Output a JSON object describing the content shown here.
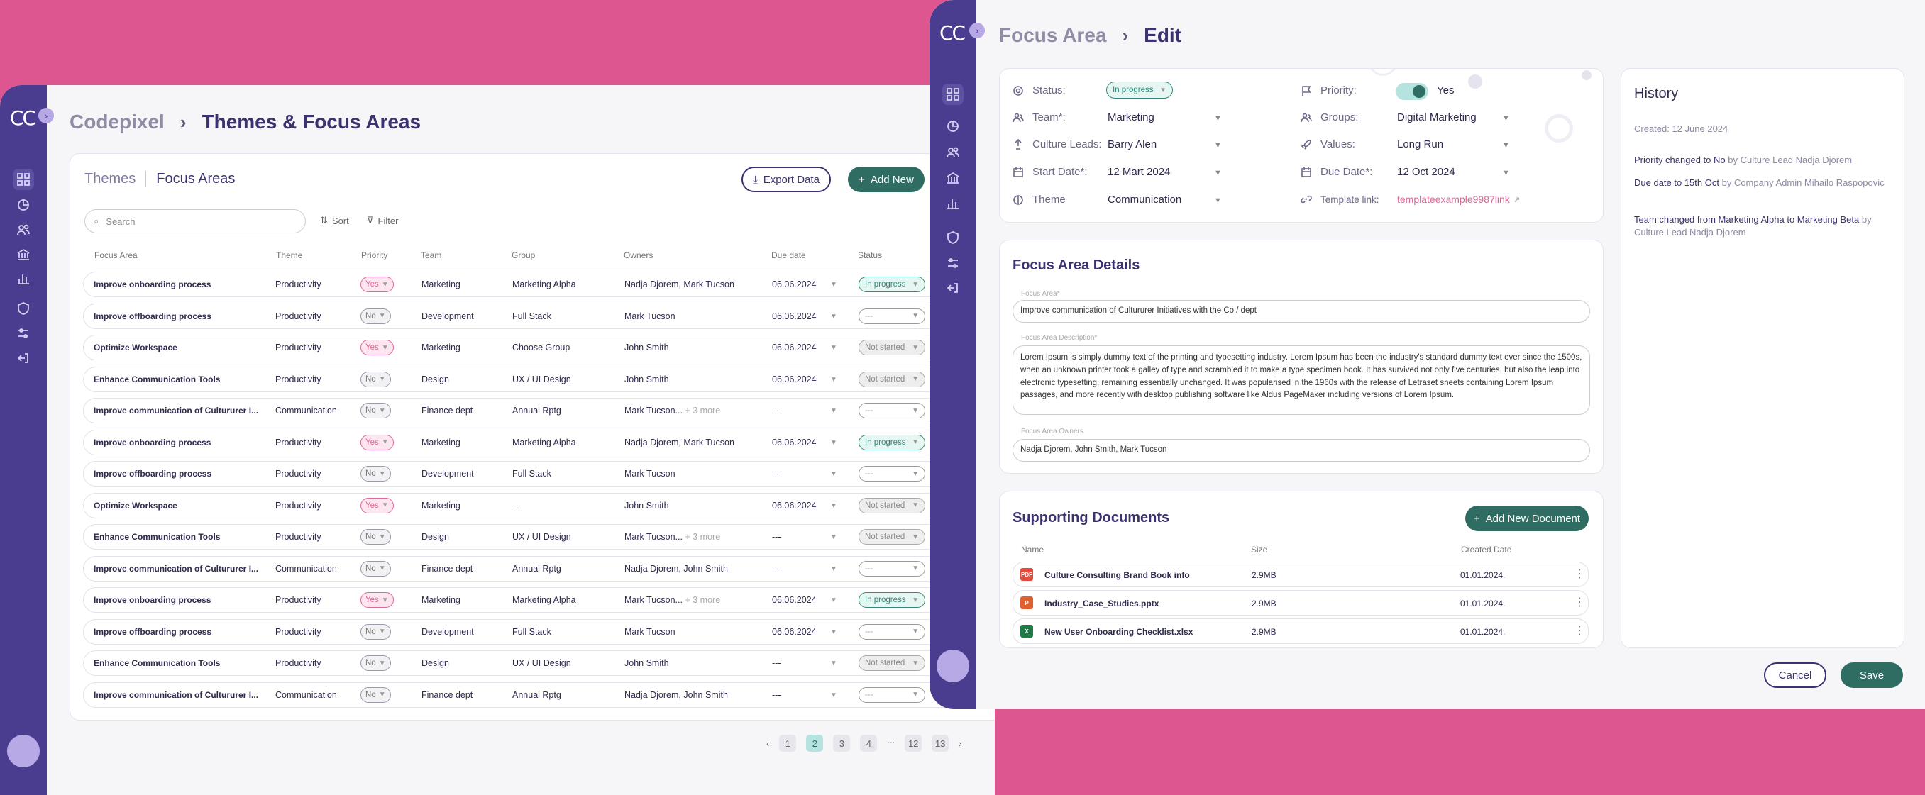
{
  "brand": {
    "logo": "CC",
    "toggle": "›"
  },
  "left": {
    "breadcrumb": [
      "Codepixel",
      "Themes & Focus Areas"
    ],
    "tabs": [
      "Themes",
      "Focus Areas"
    ],
    "export_label": "Export Data",
    "add_label": "Add New",
    "search_placeholder": "Search",
    "sort_label": "Sort",
    "filter_label": "Filter",
    "columns": [
      "Focus Area",
      "Theme",
      "Priority",
      "Team",
      "Group",
      "Owners",
      "Due date",
      "Status"
    ],
    "rows": [
      {
        "fa": "Improve onboarding process",
        "theme": "Productivity",
        "priority": "Yes",
        "team": "Marketing",
        "group": "Marketing Alpha",
        "owners": "Nadja Djorem, Mark Tucson",
        "more": "",
        "due": "06.06.2024",
        "status": "In progress"
      },
      {
        "fa": "Improve offboarding process",
        "theme": "Productivity",
        "priority": "No",
        "team": "Development",
        "group": "Full Stack",
        "owners": "Mark Tucson",
        "more": "",
        "due": "06.06.2024",
        "status": "---"
      },
      {
        "fa": "Optimize Workspace",
        "theme": "Productivity",
        "priority": "Yes",
        "team": "Marketing",
        "group": "Choose Group",
        "owners": "John Smith",
        "more": "",
        "due": "06.06.2024",
        "status": "Not started"
      },
      {
        "fa": "Enhance Communication Tools",
        "theme": "Productivity",
        "priority": "No",
        "team": "Design",
        "group": "UX / UI Design",
        "owners": "John Smith",
        "more": "",
        "due": "06.06.2024",
        "status": "Not started"
      },
      {
        "fa": "Improve communication of  Cultururer I...",
        "theme": "Communication",
        "priority": "No",
        "team": "Finance dept",
        "group": "Annual Rptg",
        "owners": "Mark Tucson...",
        "more": "+ 3 more",
        "due": "---",
        "status": "---"
      },
      {
        "fa": "Improve onboarding process",
        "theme": "Productivity",
        "priority": "Yes",
        "team": "Marketing",
        "group": "Marketing Alpha",
        "owners": "Nadja Djorem, Mark Tucson",
        "more": "",
        "due": "06.06.2024",
        "status": "In progress"
      },
      {
        "fa": "Improve offboarding process",
        "theme": "Productivity",
        "priority": "No",
        "team": "Development",
        "group": "Full Stack",
        "owners": "Mark Tucson",
        "more": "",
        "due": "---",
        "status": "---"
      },
      {
        "fa": "Optimize Workspace",
        "theme": "Productivity",
        "priority": "Yes",
        "team": "Marketing",
        "group": "---",
        "owners": "John Smith",
        "more": "",
        "due": "06.06.2024",
        "status": "Not started"
      },
      {
        "fa": "Enhance Communication Tools",
        "theme": "Productivity",
        "priority": "No",
        "team": "Design",
        "group": "UX / UI Design",
        "owners": "Mark Tucson...",
        "more": "+ 3 more",
        "due": "---",
        "status": "Not started"
      },
      {
        "fa": "Improve communication of  Cultururer I...",
        "theme": "Communication",
        "priority": "No",
        "team": "Finance dept",
        "group": "Annual Rptg",
        "owners": "Nadja Djorem, John Smith",
        "more": "",
        "due": "---",
        "status": "---"
      },
      {
        "fa": "Improve onboarding process",
        "theme": "Productivity",
        "priority": "Yes",
        "team": "Marketing",
        "group": "Marketing Alpha",
        "owners": "Mark Tucson...",
        "more": "+ 3 more",
        "due": "06.06.2024",
        "status": "In progress"
      },
      {
        "fa": "Improve offboarding process",
        "theme": "Productivity",
        "priority": "No",
        "team": "Development",
        "group": "Full Stack",
        "owners": "Mark Tucson",
        "more": "",
        "due": "06.06.2024",
        "status": "---"
      },
      {
        "fa": "Enhance Communication Tools",
        "theme": "Productivity",
        "priority": "No",
        "team": "Design",
        "group": "UX / UI Design",
        "owners": "John Smith",
        "more": "",
        "due": "---",
        "status": "Not started"
      },
      {
        "fa": "Improve communication of  Cultururer I...",
        "theme": "Communication",
        "priority": "No",
        "team": "Finance dept",
        "group": "Annual Rptg",
        "owners": "Nadja Djorem, John Smith",
        "more": "",
        "due": "---",
        "status": "---"
      }
    ],
    "pages": [
      "1",
      "2",
      "3",
      "4",
      "...",
      "12",
      "13"
    ],
    "current_page": "2"
  },
  "right": {
    "breadcrumb": [
      "Focus Area",
      "Edit"
    ],
    "form": {
      "status_label": "Status:",
      "status_value": "In progress",
      "team_label": "Team*:",
      "team_value": "Marketing",
      "leads_label": "Culture Leads:",
      "leads_value": "Barry Alen",
      "start_label": "Start Date*:",
      "start_value": "12 Mart 2024",
      "theme_label": "Theme",
      "theme_value": "Communication",
      "priority_label": "Priority:",
      "priority_value": "Yes",
      "priority_on": true,
      "groups_label": "Groups:",
      "groups_value": "Digital Marketing",
      "values_label": "Values:",
      "values_value": "Long Run",
      "due_label": "Due Date*:",
      "due_value": "12 Oct 2024",
      "template_label": "Template link:",
      "template_value": "templateexample9987link"
    },
    "details": {
      "title": "Focus Area Details",
      "fa_label": "Focus Area*",
      "fa_value": "Improve communication of  Cultururer Initiatives with the Co / dept",
      "desc_label": "Focus Area Description*",
      "desc_value": "Lorem Ipsum is simply dummy text of the printing and typesetting industry. Lorem Ipsum has been the industry's standard dummy text ever since the 1500s, when an unknown printer took a galley of type and scrambled it to make a type specimen book. It has survived not only five centuries, but also the leap into electronic typesetting, remaining essentially unchanged. It was popularised in the 1960s with the release of Letraset sheets containing Lorem Ipsum passages, and more recently with desktop publishing software like Aldus PageMaker including versions of Lorem Ipsum.",
      "owners_label": "Focus Area Owners",
      "owners_value": "Nadja Djorem, John Smith, Mark Tucson"
    },
    "docs": {
      "title": "Supporting Documents",
      "add_label": "Add New Document",
      "columns": [
        "Name",
        "Size",
        "Created Date"
      ],
      "rows": [
        {
          "name": "Culture Consulting Brand Book info",
          "size": "2.9MB",
          "date": "01.01.2024.",
          "icon": "pdf-icon"
        },
        {
          "name": "Industry_Case_Studies.pptx",
          "size": "2.9MB",
          "date": "01.01.2024.",
          "icon": "powerpoint-icon"
        },
        {
          "name": "New User Onboarding Checklist.xlsx",
          "size": "2.9MB",
          "date": "01.01.2024.",
          "icon": "excel-icon"
        }
      ]
    },
    "history": {
      "title": "History",
      "created": "Created: 12 June 2024",
      "items": [
        {
          "text": "Priority changed to No",
          "by": "by Culture Lead Nadja Djorem"
        },
        {
          "text": "Due date to 15th Oct",
          "by": "by Company Admin Mihailo Raspopovic"
        },
        {
          "text": "Team changed from Marketing Alpha to Marketing Beta",
          "by": "by Culture Lead Nadja Djorem"
        }
      ]
    },
    "cancel_label": "Cancel",
    "save_label": "Save"
  },
  "colors": {
    "background": "#dd5690",
    "sidebar": "#4a3d8f",
    "accent_green": "#2f6d63",
    "pink": "#e0659a",
    "navy": "#3b336f"
  }
}
